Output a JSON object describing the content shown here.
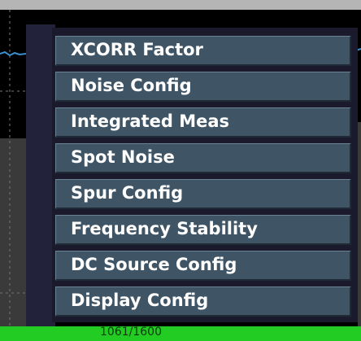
{
  "menu": {
    "items": [
      {
        "label": "XCORR Factor"
      },
      {
        "label": "Noise Config"
      },
      {
        "label": "Integrated Meas"
      },
      {
        "label": "Spot Noise"
      },
      {
        "label": "Spur Config"
      },
      {
        "label": "Frequency Stability"
      },
      {
        "label": "DC Source Config"
      },
      {
        "label": "Display Config"
      }
    ]
  },
  "status": {
    "sweep_count": "1061/1600"
  },
  "colors": {
    "menu_item_bg": "#3f5566",
    "status_bar": "#22cc22",
    "trace": "#3a8fd0"
  }
}
